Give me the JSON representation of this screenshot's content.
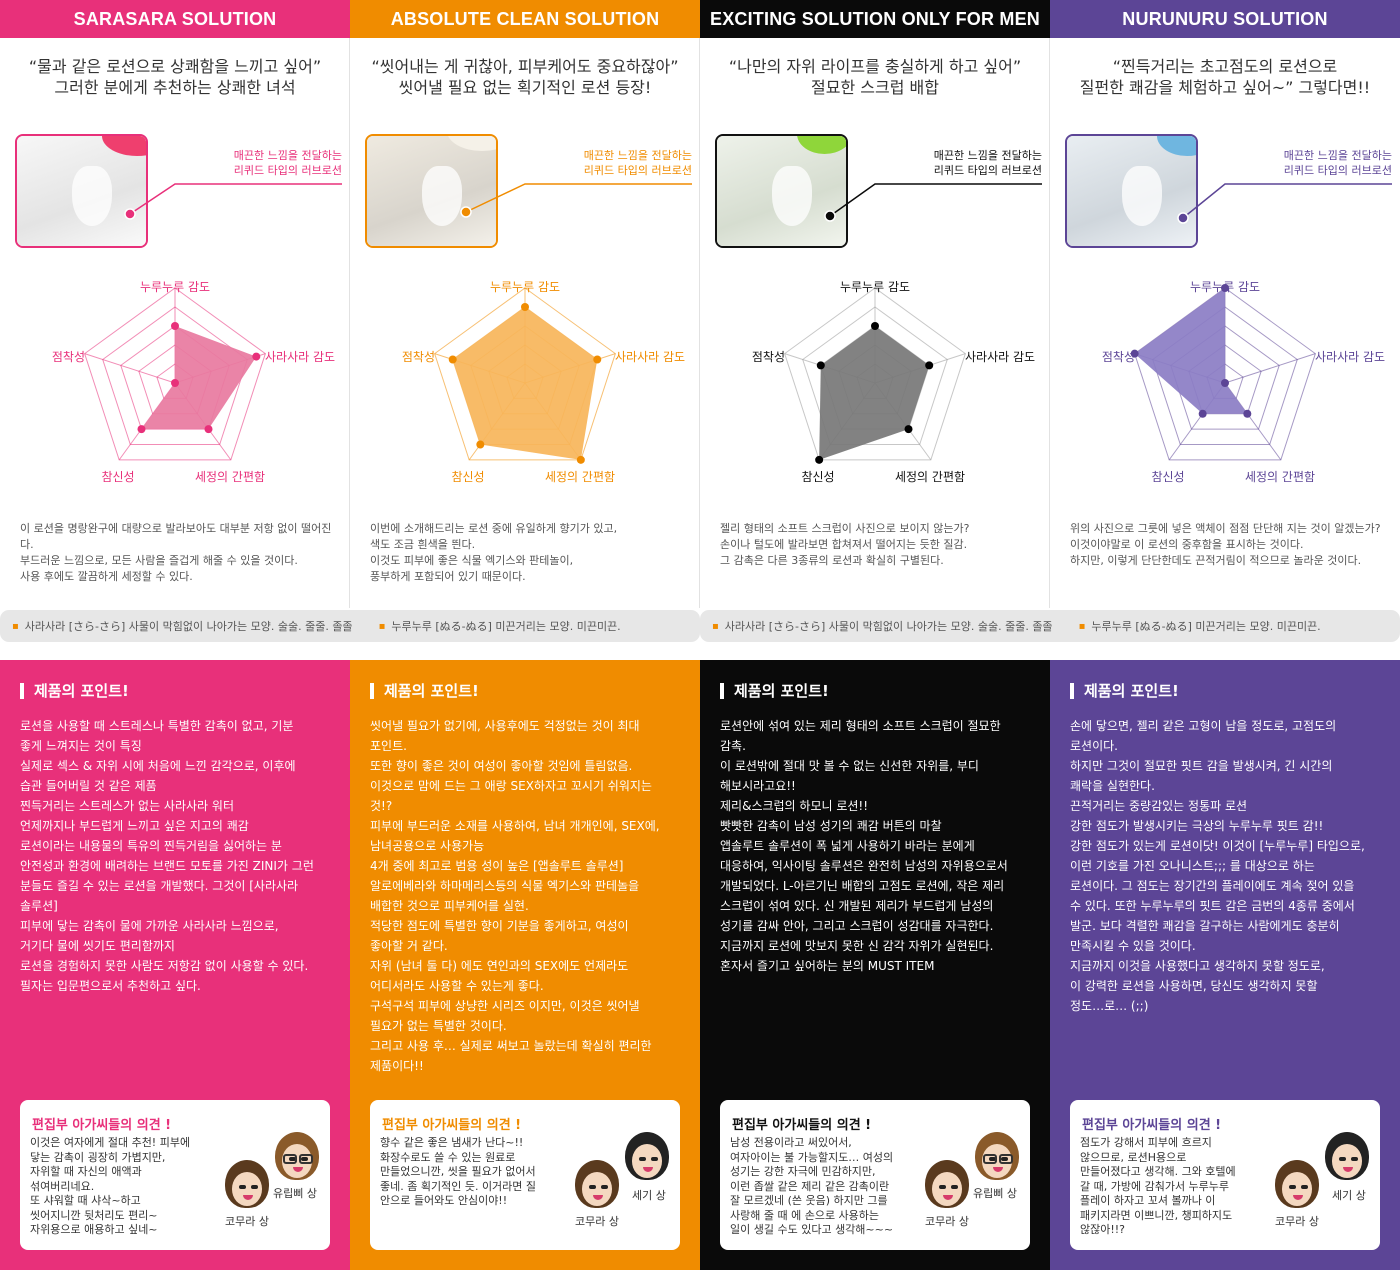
{
  "glossary": [
    {
      "items": [
        "사라사라 [さら-さら] 사물이 막힘없이 나아가는 모양. 술술. 줄줄. 졸졸",
        "누루누루 [ぬる-ぬる] 미끈거리는 모양. 미끈미끈."
      ]
    },
    {
      "items": [
        "사라사라 [さら-さら] 사물이 막힘없이 나아가는 모양. 술술. 줄줄. 졸졸",
        "누루누루 [ぬる-ぬる] 미끈거리는 모양. 미끈미끈."
      ]
    }
  ],
  "columns": [
    {
      "header": "SARASARA SOLUTION",
      "color": "#e8307a",
      "radar_fill": "#e8799f",
      "quote": [
        "“물과 같은 로션으로 상쾌함을 느끼고 싶어”",
        "그러한 분에게 추천하는 상쾌한 녀석"
      ],
      "callout": [
        "매끈한 느낌을 전달하는",
        "리퀴드 타입의 러브로션"
      ],
      "radar_labels": [
        "누루누루 감도",
        "사라사라 감도",
        "세정의 간편함",
        "참신성",
        "점착성"
      ],
      "radar_values": [
        0.6,
        0.9,
        0.6,
        0.6,
        0.0
      ],
      "desc": [
        "이 로션을 명랑완구에 대량으로 발라보아도 대부분 저항 없이 떨어진다.",
        "부드러운 느낌으로, 모든 사람을 즐겁게 해줄 수 있을 것이다.",
        "사용 후에도 깔끔하게 세정할 수 있다."
      ],
      "point_title": "제품의 포인트!",
      "point_lines": [
        "로션을 사용할 때 스트레스나 특별한 감촉이 없고, 기분",
        "좋게 느껴지는 것이 특징",
        "실제로 섹스 & 자위 시에 처음에 느낀 감각으로, 이후에",
        "습관 들어버릴 것 같은 제품",
        "찐득거리는 스트레스가 없는 사라사라 워터",
        "언제까지나 부드럽게 느끼고 싶은 지고의 쾌감",
        "로션이라는 내용물의 특유의 찐득거림을 싫어하는 분",
        "안전성과 환경에 배려하는 브랜드 모토를 가진 ZINI가 그런",
        "분들도 즐길 수 있는 로션을 개발했다. 그것이 [사라사라",
        "솔루션]",
        "피부에 닿는 감촉이 물에 가까운 사라사라 느낌으로,",
        "거기다 물에 씻기도 편리함까지",
        "로션을 경험하지 못한 사람도 저항감 없이 사용할 수 있다.",
        "필자는 입문편으로서 추천하고 싶다."
      ],
      "opinion_title": "편집부 아가씨들의 의견 !",
      "opinion_lines": [
        "이것은 여자에게 절대 추천! 피부에",
        "닿는 감촉이 굉장히 가볍지만,",
        "자위할 때 자신의 애액과",
        "섞여버리네요.",
        "또 샤워할 때 샤삭~하고",
        "씻어지니깐 뒷처리도 편리~",
        "자위용으로 애용하고 싶네~"
      ],
      "people": [
        "코무라 상",
        "유립삐 상"
      ]
    },
    {
      "header": "ABSOLUTE CLEAN SOLUTION",
      "color": "#f08c00",
      "radar_fill": "#f7b55a",
      "quote": [
        "“씻어내는 게 귀찮아, 피부케어도 중요하잖아”",
        "씻어낼 필요 없는 획기적인 로션 등장!"
      ],
      "callout": [
        "매끈한 느낌을 전달하는",
        "리퀴드 타입의 러브로션"
      ],
      "radar_labels": [
        "누루누루 감도",
        "사라사라 감도",
        "세정의 간편함",
        "참신성",
        "점착성"
      ],
      "radar_values": [
        0.8,
        0.8,
        1.0,
        0.8,
        0.8
      ],
      "desc": [
        "이번에 소개해드리는 로션 중에 유일하게 향기가 있고,",
        "색도 조금 흰색을 띈다.",
        "이것도 피부에 좋은 식물 엑기스와 판테놀이,",
        "풍부하게 포함되어 있기 때문이다."
      ],
      "point_title": "제품의 포인트!",
      "point_lines": [
        "씻어낼 필요가 없기에, 사용후에도 걱정없는 것이 최대",
        "포인트.",
        "또한 향이 좋은 것이 여성이 좋아할 것임에 틀림없음.",
        "이것으로 맘에 드는 그 애랑 SEX하자고 꼬시기 쉬워지는",
        "것!?",
        "피부에 부드러운 소재를 사용하여, 남녀 개개인에, SEX에,",
        "남녀공용으로 사용가능",
        "4개 중에 최고로 범용 성이 높은 [앱솔루트 솔루션]",
        "알로에베라와 하마메리스등의 식물 엑기스와 판테놀을",
        "배합한 것으로 피부케어를 실현.",
        "적당한 점도에 특별한 향이 기분을 좋게하고, 여성이",
        "좋아할 거 같다.",
        "자위 (남녀 둘 다) 에도 연인과의 SEX에도 언제라도",
        "어디서라도 사용할 수 있는게 좋다.",
        "구석구석 피부에 상냥한 시리즈 이지만, 이것은 씻어낼",
        "필요가 없는 특별한 것이다.",
        "그리고 사용 후… 실제로 써보고 놀랐는데 확실히 편리한",
        "제품이다!!"
      ],
      "opinion_title": "편집부 아가씨들의 의견 !",
      "opinion_lines": [
        "향수 같은 좋은 냄새가 난다~!!",
        "화장수로도 쓸 수 있는 원료로",
        "만들었으니깐, 씻을 필요가 없어서",
        "좋네. 좀 획기적인 듯. 이거라면 질",
        "안으로 들어와도 안심이야!!"
      ],
      "people": [
        "코무라 상",
        "세기 상"
      ]
    },
    {
      "header": "EXCITING SOLUTION ONLY FOR MEN",
      "color": "#0a0a0a",
      "radar_fill": "#777777",
      "quote": [
        "“나만의 자위 라이프를 충실하게 하고 싶어”",
        "절묘한 스크럽 배합"
      ],
      "callout": [
        "매끈한 느낌을 전달하는",
        "리퀴드 타입의 러브로션"
      ],
      "radar_labels": [
        "누루누루 감도",
        "사라사라 감도",
        "세정의 간편함",
        "참신성",
        "점착성"
      ],
      "radar_values": [
        0.6,
        0.6,
        0.6,
        1.0,
        0.6
      ],
      "desc": [
        "젤리 형태의 소프트 스크럽이 사진으로 보이지 않는가?",
        "손이나 털도에 발라보면 합쳐져서 떨어지는 듯한 질감.",
        "그 감촉은 다른 3종류의 로션과 확실히 구별된다."
      ],
      "point_title": "제품의 포인트!",
      "point_lines": [
        "로션안에 섞여 있는 제리 형태의 소프트 스크럽이 절묘한",
        "감촉.",
        "이 로션밖에 절대 맛 볼 수 없는 신선한 자위를, 부디",
        "해보시라고요!!",
        "제리&스크럽의 하모니 로션!!",
        "빳빳한 감촉이 남성 성기의 쾌감 버튼의 마찰",
        "앱솔루트 솔루션이 폭 넓게 사용하기 바라는 분에게",
        "대응하여, 익사이팅 솔루션은 완전히 남성의 자위용으로서",
        "개발되었다. L-아르기닌 배합의 고점도 로션에, 작은 제리",
        "스크럽이 섞여 있다. 신 개발된 제리가 부드럽게 남성의",
        "성기를 감싸 안아, 그리고 스크럽이 성감대를 자극한다.",
        "지금까지 로션에 맛보지 못한 신 감각 자위가 실현된다.",
        "혼자서 즐기고 싶어하는 분의 MUST ITEM"
      ],
      "opinion_title": "편집부 아가씨들의 의견 !",
      "opinion_lines": [
        "남성 전용이라고 써있어서,",
        "여자아이는 불 가능할지도… 여성의",
        "성기는 강한 자극에 민감하지만,",
        "이런 좁쌀 같은 제리 같은 감촉이란",
        "잘 모르겠네 (쓴 웃음) 하지만 그를",
        "사랑해 줄 때 에 손으로 사용하는",
        "일이 생길 수도 있다고 생각해~~~"
      ],
      "people": [
        "코무라 상",
        "유립삐 상"
      ]
    },
    {
      "header": "NURUNURU  SOLUTION",
      "color": "#5c4596",
      "radar_fill": "#8b7dc4",
      "quote": [
        "“찐득거리는 초고점도의 로션으로",
        "질펀한 쾌감을 체험하고 싶어~” 그렇다면!!"
      ],
      "callout": [
        "매끈한 느낌을 전달하는",
        "리퀴드 타입의 러브로션"
      ],
      "radar_labels": [
        "누루누루 감도",
        "사라사라 감도",
        "세정의 간편함",
        "참신성",
        "점착성"
      ],
      "radar_values": [
        1.0,
        0.0,
        0.4,
        0.4,
        1.0
      ],
      "desc": [
        "위의 사진으로 그릇에 넣은 액체이 점점 단단해 지는 것이 알겠는가?",
        "이것이야말로 이 로션의 중후함을 표시하는 것이다.",
        "하지만, 이렇게 단단한데도 끈적거림이 적으므로 놀라운 것이다."
      ],
      "point_title": "제품의 포인트!",
      "point_lines": [
        "손에 닿으면, 젤리 같은 고형이 남을 정도로, 고점도의",
        "로션이다.",
        "하지만 그것이 절묘한 핏트 감을 발생시켜, 긴 시간의",
        "쾌락을 실현한다.",
        "끈적거리는 중량감있는 정통파 로션",
        "강한 점도가 발생시키는 극상의 누루누루 핏트 감!!",
        "강한 점도가 있는게 로션이닷! 이것이 [누루누루] 타입으로,",
        "이런 기호를 가진 오나니스트;;; 를 대상으로 하는",
        "로션이다. 그 점도는 장기간의 플레이에도 계속 젖어 있을",
        "수 있다. 또한 누루누루의 핏트 감은 금번의 4종류 중에서",
        "발군. 보다 격렬한 쾌감을 갈구하는 사람에게도 충분히",
        "만족시킬 수 있을 것이다.",
        "지금까지 이것을 사용했다고 생각하지 못할 정도로,",
        "이 강력한 로션을 사용하면, 당신도 생각하지 못할",
        "정도…로… (;;)"
      ],
      "opinion_title": "편집부 아가씨들의 의견 !",
      "opinion_lines": [
        "점도가 강해서 피부에 흐르지",
        "않으므로, 로션H용으로",
        "만들어졌다고 생각해. 그와 호텔에",
        "갈 때, 가방에 감춰가서 누루누루",
        "플레이 하자고 꼬셔 볼까나 이",
        "패키지라면 이쁘니깐, 챙피하지도",
        "않잖아!!?"
      ],
      "people": [
        "코무라 상",
        "세기 상"
      ]
    }
  ]
}
